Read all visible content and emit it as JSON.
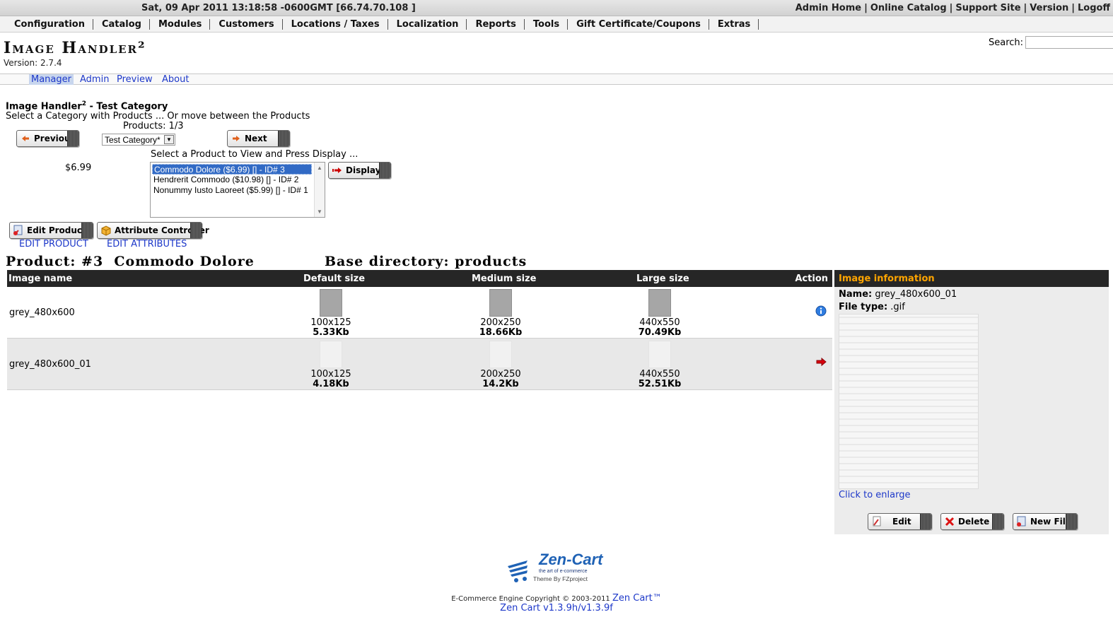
{
  "topbar": {
    "datetime": "Sat, 09 Apr 2011 13:18:58 -0600GMT [66.74.70.108 ]",
    "links": [
      "Admin Home",
      "Online Catalog",
      "Support Site",
      "Version",
      "Logoff"
    ]
  },
  "menu": [
    "Configuration",
    "Catalog",
    "Modules",
    "Customers",
    "Locations / Taxes",
    "Localization",
    "Reports",
    "Tools",
    "Gift Certificate/Coupons",
    "Extras"
  ],
  "header": {
    "title": "Image Handler²",
    "version": "Version: 2.7.4",
    "search_label": "Search:",
    "search_value": ""
  },
  "tabs": [
    "Manager",
    "Admin",
    "Preview",
    "About"
  ],
  "manager": {
    "heading_main": "Image Handler",
    "heading_sup": "2",
    "heading_rest": " - Test Category",
    "subtitle": "Select a Category with Products ... Or move between the Products",
    "products_count": "Products: 1/3",
    "prev_label": "Previous",
    "next_label": "Next",
    "category_value": "Test Category*",
    "select_hint": "Select a Product to View and Press Display ...",
    "price": "$6.99",
    "products": [
      "Commodo Dolore ($6.99) [] - ID# 3",
      "Hendrerit Commodo ($10.98) [] - ID# 2",
      "Nonummy Iusto Laoreet ($5.99) [] - ID# 1"
    ],
    "display_label": "Display",
    "edit_product_label": "Edit Product",
    "attribute_controller_label": "Attribute Controller",
    "edit_product_link": "EDIT PRODUCT",
    "edit_attributes_link": "EDIT ATTRIBUTES",
    "product_heading": "Product: #3  Commodo Dolore",
    "base_dir_heading": "Base directory: products"
  },
  "table": {
    "headers": [
      "Image name",
      "Default size",
      "Medium size",
      "Large size",
      "Action"
    ],
    "rows": [
      {
        "name": "grey_480x600",
        "default": {
          "dims": "100x125",
          "size": "5.33Kb"
        },
        "medium": {
          "dims": "200x250",
          "size": "18.66Kb"
        },
        "large": {
          "dims": "440x550",
          "size": "70.49Kb"
        },
        "action_icon": "info-icon"
      },
      {
        "name": "grey_480x600_01",
        "default": {
          "dims": "100x125",
          "size": "4.18Kb"
        },
        "medium": {
          "dims": "200x250",
          "size": "14.2Kb"
        },
        "large": {
          "dims": "440x550",
          "size": "52.51Kb"
        },
        "action_icon": "arrow-right-icon"
      }
    ]
  },
  "info": {
    "title": "Image information",
    "name_label": "Name:",
    "name_value": " grey_480x600_01",
    "type_label": "File type:",
    "type_value": " .gif",
    "enlarge": "Click to enlarge",
    "edit_label": "Edit",
    "delete_label": "Delete",
    "newfile_label": "New File"
  },
  "footer": {
    "logo_text": "Zen-Cart",
    "logo_tagline": "the art of e-commerce",
    "logo_theme": "Theme By FZproject",
    "copyright": "E-Commerce Engine Copyright © 2003-2011 ",
    "zencart_link": "Zen Cart™",
    "version": "Zen Cart v1.3.9h/v1.3.9f"
  },
  "colors": {
    "header_bg": "#262626",
    "info_title": "#ffa500",
    "link": "#1d38c9",
    "selected": "#316ac5"
  }
}
